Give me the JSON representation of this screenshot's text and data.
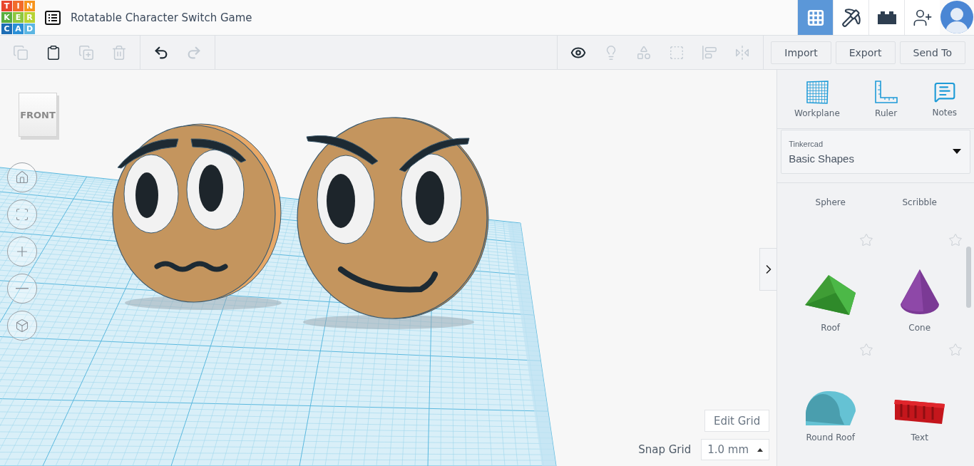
{
  "logo": [
    {
      "letter": "T",
      "color": "#e8452c"
    },
    {
      "letter": "I",
      "color": "#f26b2a"
    },
    {
      "letter": "N",
      "color": "#f7941d"
    },
    {
      "letter": "K",
      "color": "#5aae3e"
    },
    {
      "letter": "E",
      "color": "#8dc63f"
    },
    {
      "letter": "R",
      "color": "#b7d334"
    },
    {
      "letter": "C",
      "color": "#1c6db5"
    },
    {
      "letter": "A",
      "color": "#2a8fd6"
    },
    {
      "letter": "D",
      "color": "#5cb6e2"
    }
  ],
  "project_title": "Rotatable Character Switch Game",
  "view_modes": [
    {
      "kind": "grid",
      "selected": true
    },
    {
      "kind": "pickaxe",
      "selected": false
    },
    {
      "kind": "bricks",
      "selected": false
    }
  ],
  "edit_tools": [
    {
      "kind": "copy",
      "disabled": true
    },
    {
      "kind": "paste",
      "disabled": false
    },
    {
      "kind": "duplicate",
      "disabled": true
    },
    {
      "kind": "delete",
      "disabled": true
    }
  ],
  "history_tools": [
    {
      "kind": "undo",
      "disabled": false
    },
    {
      "kind": "redo",
      "disabled": true
    }
  ],
  "shape_tools": [
    {
      "kind": "notes",
      "disabled": false
    },
    {
      "kind": "light",
      "disabled": true
    },
    {
      "kind": "group",
      "disabled": true
    },
    {
      "kind": "hole",
      "disabled": true
    },
    {
      "kind": "align",
      "disabled": true
    },
    {
      "kind": "mirror",
      "disabled": true
    }
  ],
  "actions": [
    "Import",
    "Export",
    "Send To"
  ],
  "view_cube": "FRONT",
  "nav_controls": [
    {
      "kind": "home"
    },
    {
      "kind": "fit"
    },
    {
      "kind": "zoom_in"
    },
    {
      "kind": "zoom_out"
    },
    {
      "kind": "perspective"
    }
  ],
  "panel_tools": [
    {
      "kind": "workplane",
      "label": "Workplane"
    },
    {
      "kind": "ruler",
      "label": "Ruler"
    },
    {
      "kind": "notes",
      "label": "Notes"
    }
  ],
  "library": {
    "source": "Tinkercad",
    "category": "Basic Shapes"
  },
  "shapes": [
    {
      "kind": "sphere",
      "name": "Sphere"
    },
    {
      "kind": "scribble",
      "name": "Scribble"
    },
    {
      "kind": "roof",
      "name": "Roof"
    },
    {
      "kind": "cone",
      "name": "Cone"
    },
    {
      "kind": "round_roof",
      "name": "Round Roof"
    },
    {
      "kind": "text",
      "name": "Text"
    }
  ],
  "grid": {
    "edit_label": "Edit Grid",
    "snap_label": "Snap Grid",
    "snap_value": "1.0 mm"
  }
}
